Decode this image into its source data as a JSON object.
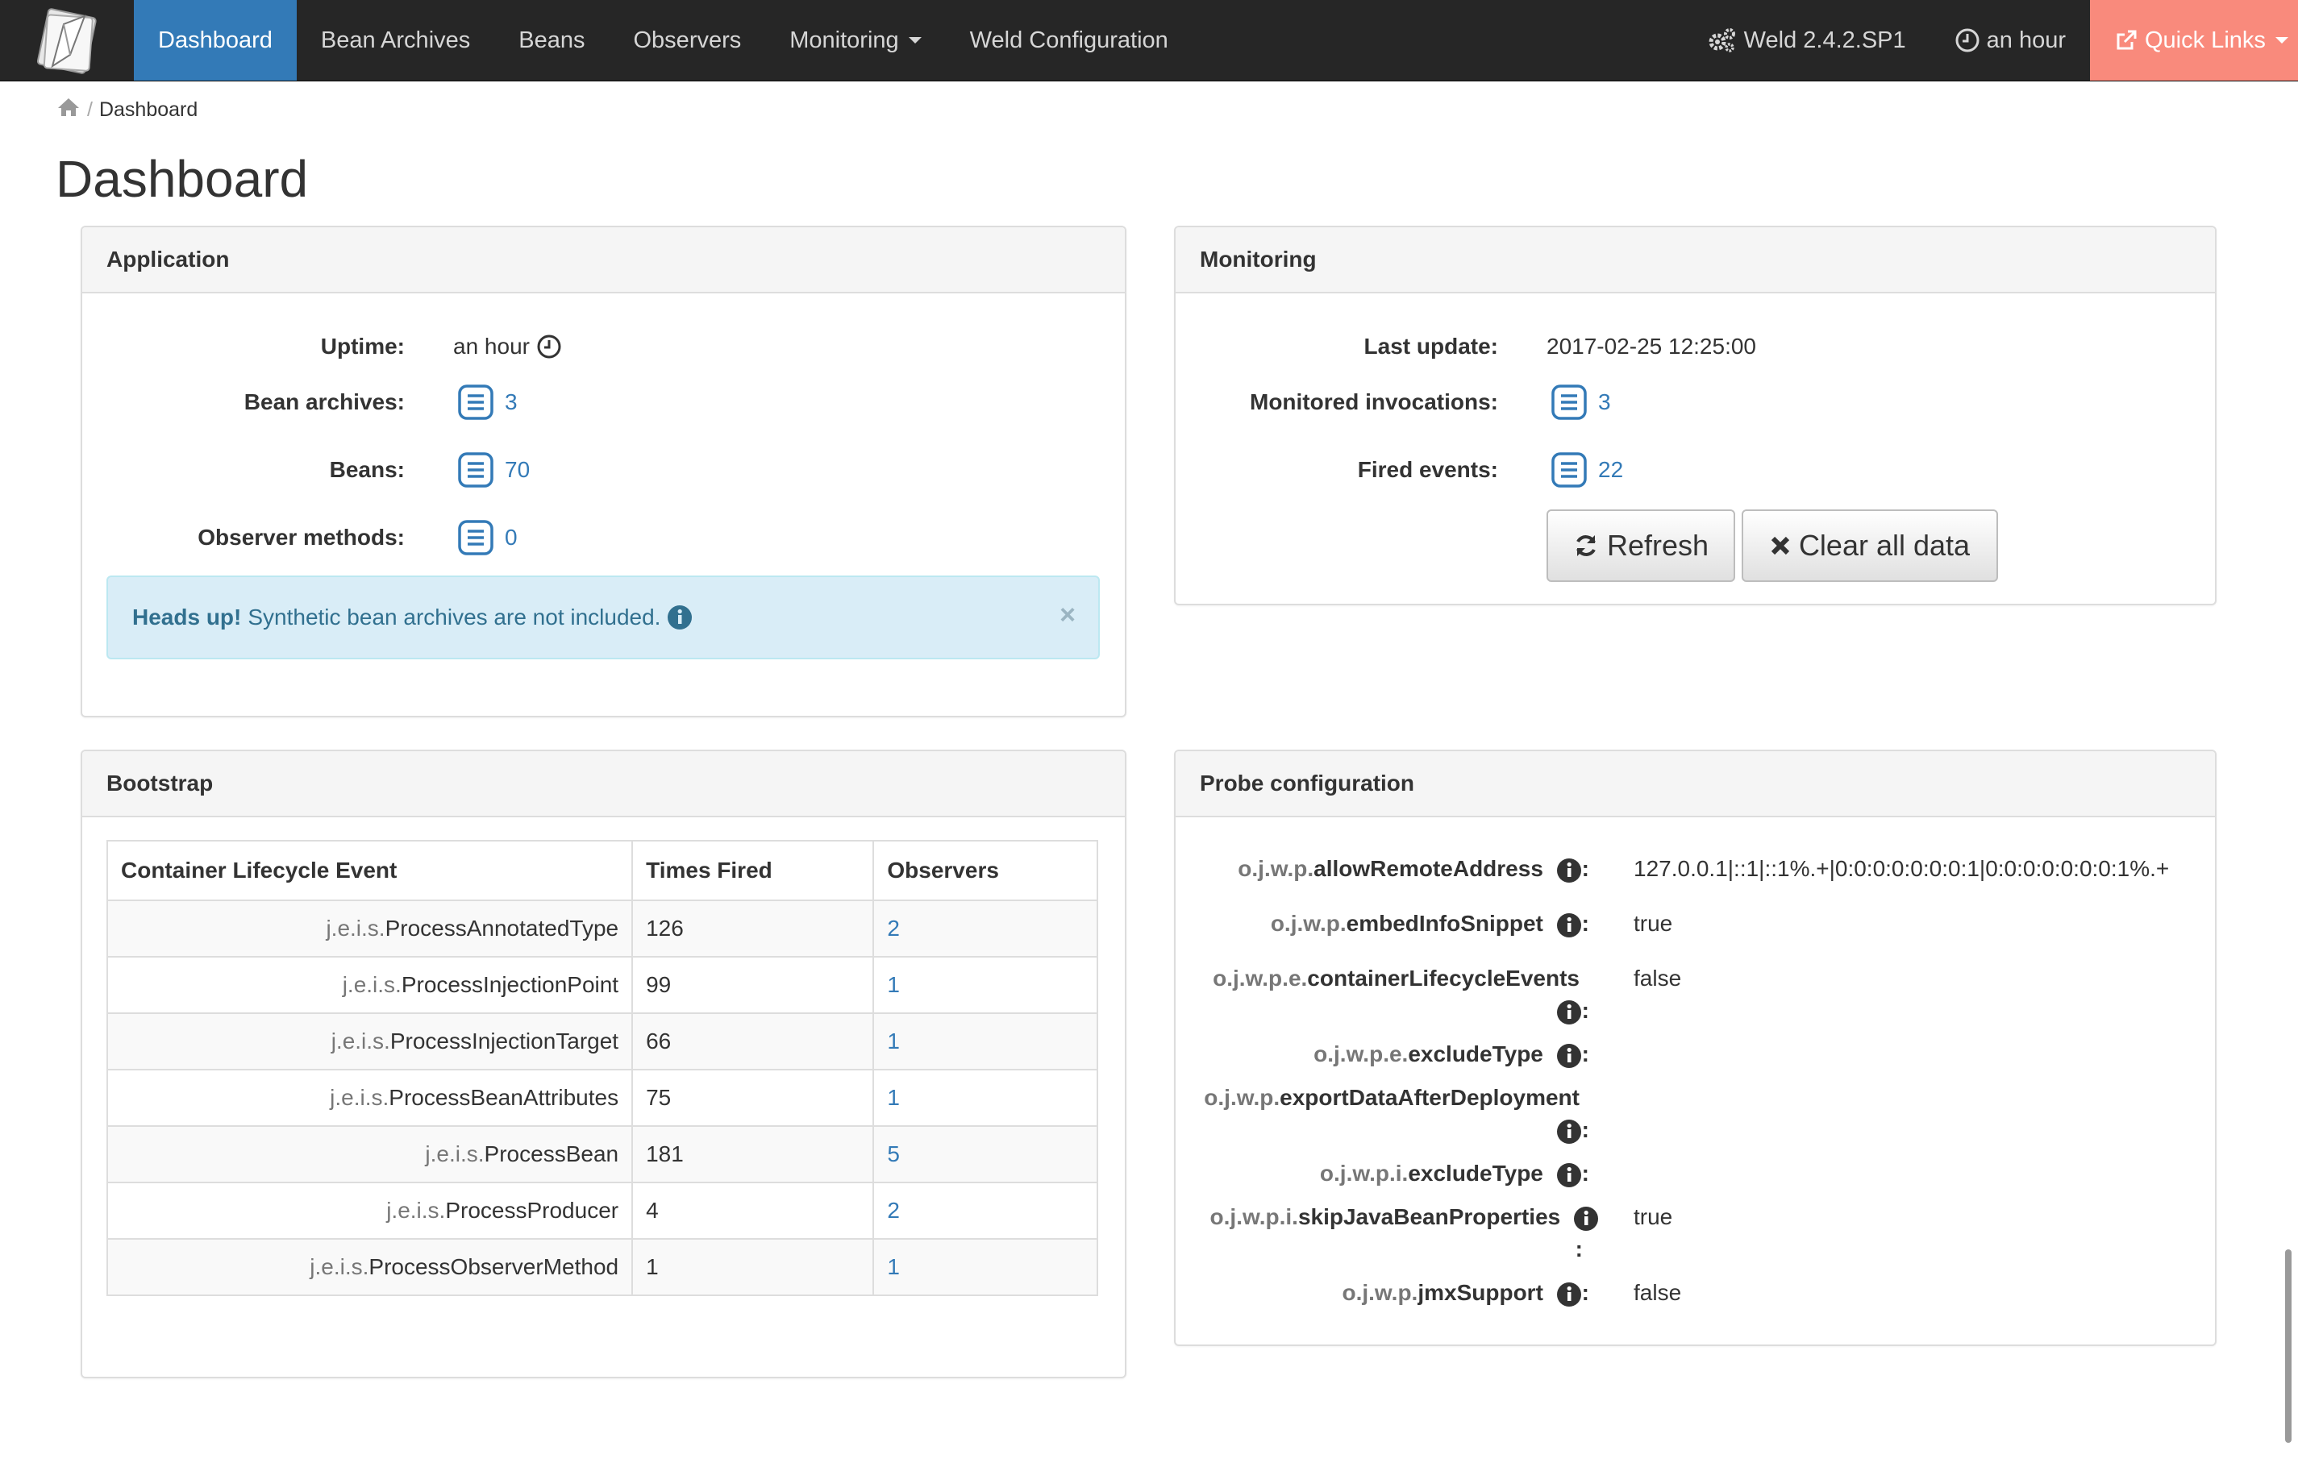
{
  "nav": {
    "items": [
      {
        "label": "Dashboard"
      },
      {
        "label": "Bean Archives"
      },
      {
        "label": "Beans"
      },
      {
        "label": "Observers"
      },
      {
        "label": "Monitoring"
      },
      {
        "label": "Weld Configuration"
      }
    ],
    "version": "Weld 2.4.2.SP1",
    "uptime": "an hour",
    "quick_links": "Quick Links",
    "accent_color": "#337ab7",
    "quick_links_color": "#f98a7c"
  },
  "breadcrumb": {
    "separator": "/",
    "current": "Dashboard"
  },
  "page_title": "Dashboard",
  "application": {
    "title": "Application",
    "uptime_label": "Uptime:",
    "uptime_value": "an hour",
    "bean_archives_label": "Bean archives:",
    "bean_archives_value": "3",
    "beans_label": "Beans:",
    "beans_value": "70",
    "observers_label": "Observer methods:",
    "observers_value": "0",
    "alert_strong": "Heads up!",
    "alert_text": "Synthetic bean archives are not included.",
    "alert_close": "×"
  },
  "monitoring": {
    "title": "Monitoring",
    "last_update_label": "Last update:",
    "last_update_value": "2017-02-25 12:25:00",
    "invocations_label": "Monitored invocations:",
    "invocations_value": "3",
    "fired_label": "Fired events:",
    "fired_value": "22",
    "refresh_label": "Refresh",
    "clear_label": "Clear all data"
  },
  "bootstrap": {
    "title": "Bootstrap",
    "columns": [
      "Container Lifecycle Event",
      "Times Fired",
      "Observers"
    ],
    "rows": [
      {
        "prefix": "j.e.i.s.",
        "event": "ProcessAnnotatedType",
        "fired": "126",
        "observers": "2"
      },
      {
        "prefix": "j.e.i.s.",
        "event": "ProcessInjectionPoint",
        "fired": "99",
        "observers": "1"
      },
      {
        "prefix": "j.e.i.s.",
        "event": "ProcessInjectionTarget",
        "fired": "66",
        "observers": "1"
      },
      {
        "prefix": "j.e.i.s.",
        "event": "ProcessBeanAttributes",
        "fired": "75",
        "observers": "1"
      },
      {
        "prefix": "j.e.i.s.",
        "event": "ProcessBean",
        "fired": "181",
        "observers": "5"
      },
      {
        "prefix": "j.e.i.s.",
        "event": "ProcessProducer",
        "fired": "4",
        "observers": "2"
      },
      {
        "prefix": "j.e.i.s.",
        "event": "ProcessObserverMethod",
        "fired": "1",
        "observers": "1"
      }
    ]
  },
  "probe": {
    "title": "Probe configuration",
    "colon": ":",
    "items": [
      {
        "prefix": "o.j.w.p.",
        "name": "allowRemoteAddress",
        "value": "127.0.0.1|::1|::1%.+|0:0:0:0:0:0:0:1|0:0:0:0:0:0:0:1%.+"
      },
      {
        "prefix": "o.j.w.p.",
        "name": "embedInfoSnippet",
        "value": "true"
      },
      {
        "prefix": "o.j.w.p.e.",
        "name": "containerLifecycleEvents",
        "value": "false"
      },
      {
        "prefix": "o.j.w.p.e.",
        "name": "excludeType",
        "value": ""
      },
      {
        "prefix": "o.j.w.p.",
        "name": "exportDataAfterDeployment",
        "value": ""
      },
      {
        "prefix": "o.j.w.p.i.",
        "name": "excludeType",
        "value": ""
      },
      {
        "prefix": "o.j.w.p.i.",
        "name": "skipJavaBeanProperties",
        "value": "true"
      },
      {
        "prefix": "o.j.w.p.",
        "name": "jmxSupport",
        "value": "false"
      }
    ]
  }
}
